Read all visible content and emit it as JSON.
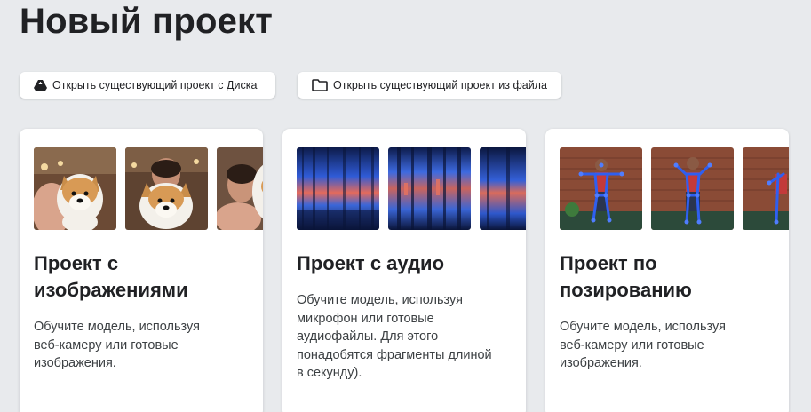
{
  "page": {
    "title": "Новый проект"
  },
  "actions": {
    "open_drive": {
      "label": "Открыть существующий проект с Диска",
      "icon": "google-drive-icon"
    },
    "open_file": {
      "label": "Открыть существующий проект из файла",
      "icon": "folder-icon"
    }
  },
  "cards": [
    {
      "id": "image",
      "title_line1": "Проект с",
      "title_line2": "изображениями",
      "desc_lines": [
        "Обучите модель, используя",
        "веб-камеру или готовые",
        "изображения."
      ]
    },
    {
      "id": "audio",
      "title_line1": "Проект с аудио",
      "desc_lines": [
        "Обучите модель, используя",
        "микрофон или готовые",
        "аудиофайлы. Для этого",
        "понадобятся фрагменты длиной",
        "в секунду)."
      ]
    },
    {
      "id": "pose",
      "title_line1": "Проект по",
      "title_line2": "позированию",
      "desc_lines": [
        "Обучите модель, используя",
        "веб-камеру или готовые",
        "изображения."
      ]
    }
  ],
  "colors": {
    "background": "#e8eaed",
    "card": "#ffffff",
    "text": "#202124"
  }
}
